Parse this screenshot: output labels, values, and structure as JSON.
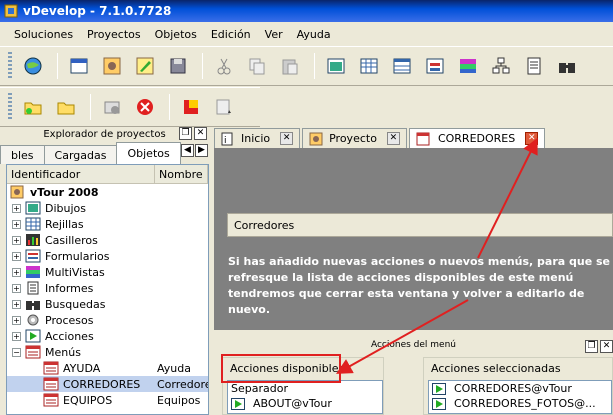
{
  "window": {
    "title": "vDevelop - 7.1.0.7728"
  },
  "menu": [
    "Soluciones",
    "Proyectos",
    "Objetos",
    "Edición",
    "Ver",
    "Ayuda"
  ],
  "explorer": {
    "title": "Explorador de proyectos",
    "tabs": [
      "bles",
      "Cargadas",
      "Objetos"
    ],
    "columns": [
      "Identificador",
      "Nombre"
    ],
    "root": "vTour 2008",
    "items": [
      "Dibujos",
      "Rejillas",
      "Casilleros",
      "Formularios",
      "MultiVistas",
      "Informes",
      "Busquedas",
      "Procesos",
      "Acciones",
      "Menús"
    ],
    "children": [
      {
        "id": "AYUDA",
        "name": "Ayuda"
      },
      {
        "id": "CORREDORES",
        "name": "Corredore"
      },
      {
        "id": "EQUIPOS",
        "name": "Equipos"
      }
    ]
  },
  "doc_tabs": [
    "Inicio",
    "Proyecto",
    "CORREDORES"
  ],
  "form": {
    "field_value": "Corredores",
    "notice": "Si has añadido nuevas acciones o nuevos menús, para que se refresque la lista de acciones disponibles de este menú tendremos que cerrar esta ventana y volver a editarlo de nuevo.",
    "section_title": "Acciones del menú",
    "available_label": "Acciones disponibles",
    "available_items": [
      "Separador",
      "ABOUT@vTour"
    ],
    "selected_label": "Acciones seleccionadas",
    "selected_items": [
      "CORREDORES@vTour",
      "CORREDORES_FOTOS@..."
    ]
  },
  "colors": {
    "highlight": "#e02020",
    "title_bar": "#0050d8"
  }
}
